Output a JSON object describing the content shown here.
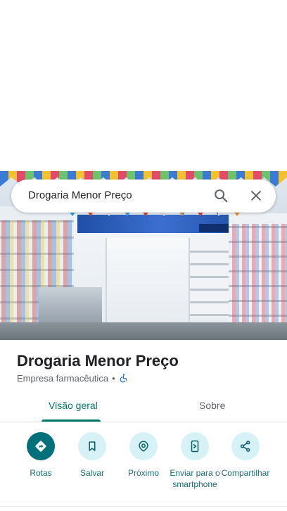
{
  "search": {
    "query": "Drogaria Menor Preço"
  },
  "place": {
    "name": "Drogaria Menor Preço",
    "category": "Empresa farmacêutica",
    "separator": "•"
  },
  "tabs": [
    {
      "label": "Visão geral",
      "active": true
    },
    {
      "label": "Sobre",
      "active": false
    }
  ],
  "actions": [
    {
      "label": "Rotas",
      "icon": "directions-icon"
    },
    {
      "label": "Salvar",
      "icon": "bookmark-icon"
    },
    {
      "label": "Próximo",
      "icon": "nearby-icon"
    },
    {
      "label": "Enviar para o smartphone",
      "icon": "send-to-phone-icon"
    },
    {
      "label": "Compartilhar",
      "icon": "share-icon"
    }
  ],
  "colors": {
    "accent": "#00796b",
    "action_bg": "#d7f2f6",
    "primary_action_bg": "#00707a"
  }
}
